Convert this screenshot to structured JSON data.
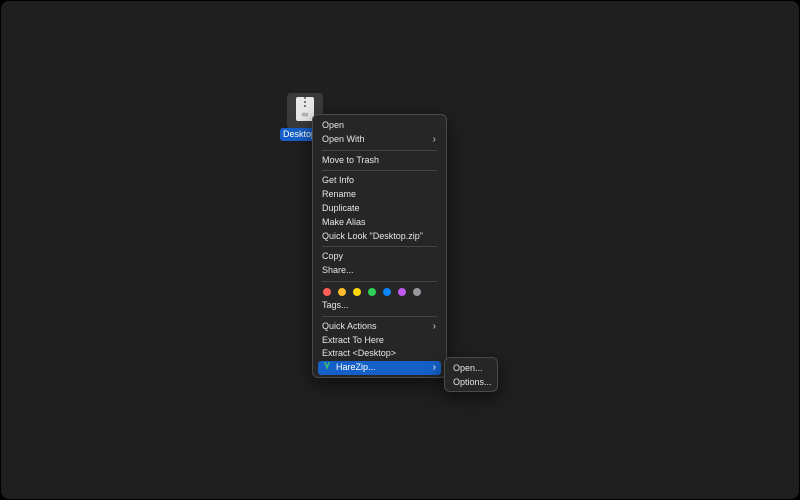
{
  "desktop": {
    "file": {
      "name": "Desktop.zip",
      "icon_text": "zip"
    }
  },
  "context_menu": {
    "open": "Open",
    "open_with": "Open With",
    "move_to_trash": "Move to Trash",
    "get_info": "Get Info",
    "rename": "Rename",
    "duplicate": "Duplicate",
    "make_alias": "Make Alias",
    "quick_look": "Quick Look \"Desktop.zip\"",
    "copy": "Copy",
    "share": "Share...",
    "tag_colors": [
      "#ff5f57",
      "#febc2e",
      "#ffd60a",
      "#30d158",
      "#0a84ff",
      "#bf5af2",
      "#98989d"
    ],
    "tags": "Tags...",
    "quick_actions": "Quick Actions",
    "extract_to_here": "Extract To Here",
    "extract_desktop": "Extract <Desktop>",
    "harezip": "HareZip...",
    "highlight_color": "#1560c8"
  },
  "submenu": {
    "open": "Open...",
    "options": "Options..."
  }
}
